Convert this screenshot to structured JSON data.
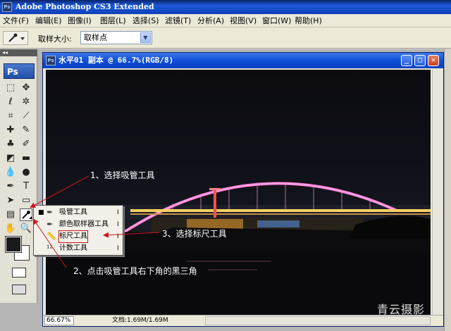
{
  "app": {
    "title": "Adobe Photoshop CS3 Extended",
    "icon": "Ps"
  },
  "menu": [
    "文件(F)",
    "编辑(E)",
    "图像(I)",
    "图层(L)",
    "选择(S)",
    "滤镜(T)",
    "分析(A)",
    "视图(V)",
    "窗口(W)",
    "帮助(H)"
  ],
  "options": {
    "sample_size_label": "取样大小:",
    "sample_size_value": "取样点"
  },
  "toolbox": {
    "logo": "Ps",
    "collapse": "◂◂"
  },
  "document": {
    "title": "水平01 副本 @ 66.7%(RGB/8)",
    "icon": "Ps",
    "zoom": "66.67%",
    "doc_size": "文档:1.69M/1.69M"
  },
  "flyout": {
    "items": [
      {
        "label": "吸管工具",
        "key": "I",
        "selected": true,
        "icon": "eyedropper-icon"
      },
      {
        "label": "颜色取样器工具",
        "key": "I",
        "selected": false,
        "icon": "color-sampler-icon"
      },
      {
        "label": "标尺工具",
        "key": "I",
        "selected": false,
        "icon": "ruler-icon"
      },
      {
        "label": "计数工具",
        "key": "I",
        "selected": false,
        "icon": "count-icon"
      }
    ]
  },
  "annotations": {
    "step1": "1、选择吸管工具",
    "step2": "2、点击吸管工具右下角的黑三角",
    "step3": "3、选择标尺工具",
    "watermark": "青云摄影"
  },
  "colors": {
    "annotation_line": "#d0141e",
    "titlebar": "#0a3fb8",
    "foreground": "#1a1a1a",
    "background": "#ffffff"
  }
}
